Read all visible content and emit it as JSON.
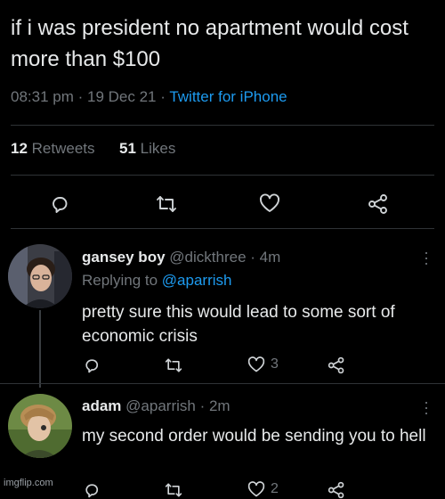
{
  "main_tweet": {
    "text": "if i was president no apartment would cost more than $100",
    "time": "08:31 pm",
    "date": "19 Dec 21",
    "source": "Twitter for iPhone",
    "retweets_count": "12",
    "retweets_label": "Retweets",
    "likes_count": "51",
    "likes_label": "Likes"
  },
  "replies": [
    {
      "name": "gansey boy",
      "handle": "@dickthree",
      "time": "4m",
      "replying_label": "Replying to",
      "replying_to": "@aparrish",
      "text": "pretty sure this would lead to some sort of economic crisis",
      "like_count": "3"
    },
    {
      "name": "adam",
      "handle": "@aparrish",
      "time": "2m",
      "text": "my second order would be sending you to hell",
      "like_count": "2"
    }
  ],
  "icons": [
    "reply-icon",
    "retweet-icon",
    "like-icon",
    "share-icon",
    "more-icon"
  ],
  "colors": {
    "background": "#000000",
    "text": "#e7e9ea",
    "muted": "#71767b",
    "accent": "#1d9bf0"
  },
  "watermark": "imgflip.com"
}
